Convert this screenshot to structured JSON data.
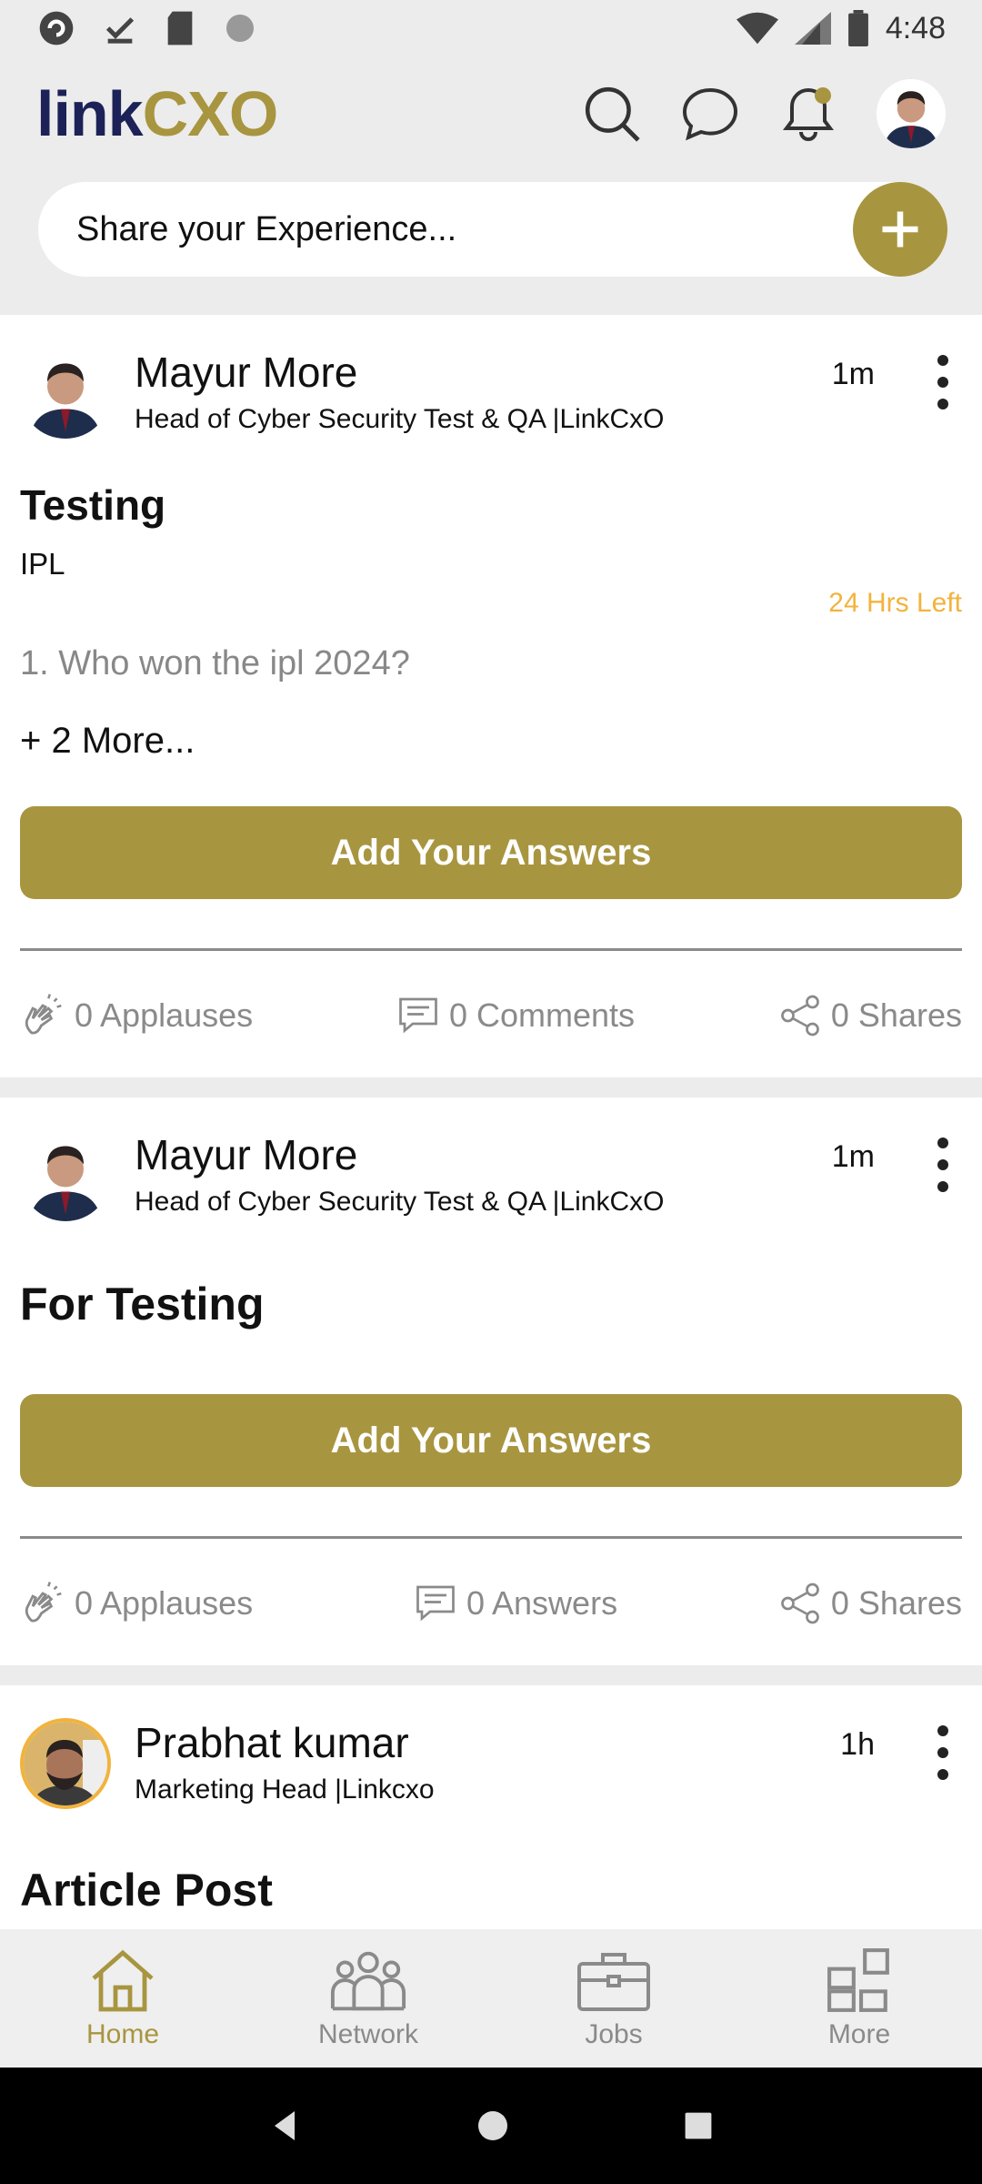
{
  "status": {
    "time": "4:48"
  },
  "app": {
    "logo_part1": "link",
    "logo_part2": "CXO",
    "share_placeholder": "Share your Experience...",
    "accent": "#a8953f"
  },
  "posts": [
    {
      "name": "Mayur More",
      "title": "Head of Cyber Security Test & QA |LinkCxO",
      "time": "1m",
      "post_title": "Testing",
      "post_subtitle": "IPL",
      "hrs_left": "24 Hrs Left",
      "question": "1. Who won the ipl 2024?",
      "more": "+ 2 More...",
      "answer_button": "Add Your Answers",
      "applauses": "0 Applauses",
      "comments": "0 Comments",
      "shares": "0 Shares"
    },
    {
      "name": "Mayur More",
      "title": "Head of Cyber Security Test & QA |LinkCxO",
      "time": "1m",
      "post_title": "For Testing",
      "answer_button": "Add Your Answers",
      "applauses": "0 Applauses",
      "answers": "0 Answers",
      "shares": "0 Shares"
    },
    {
      "name": "Prabhat kumar",
      "title": "Marketing Head |Linkcxo",
      "time": "1h",
      "post_title": "Article Post"
    }
  ],
  "nav": {
    "home": "Home",
    "network": "Network",
    "jobs": "Jobs",
    "more": "More"
  }
}
